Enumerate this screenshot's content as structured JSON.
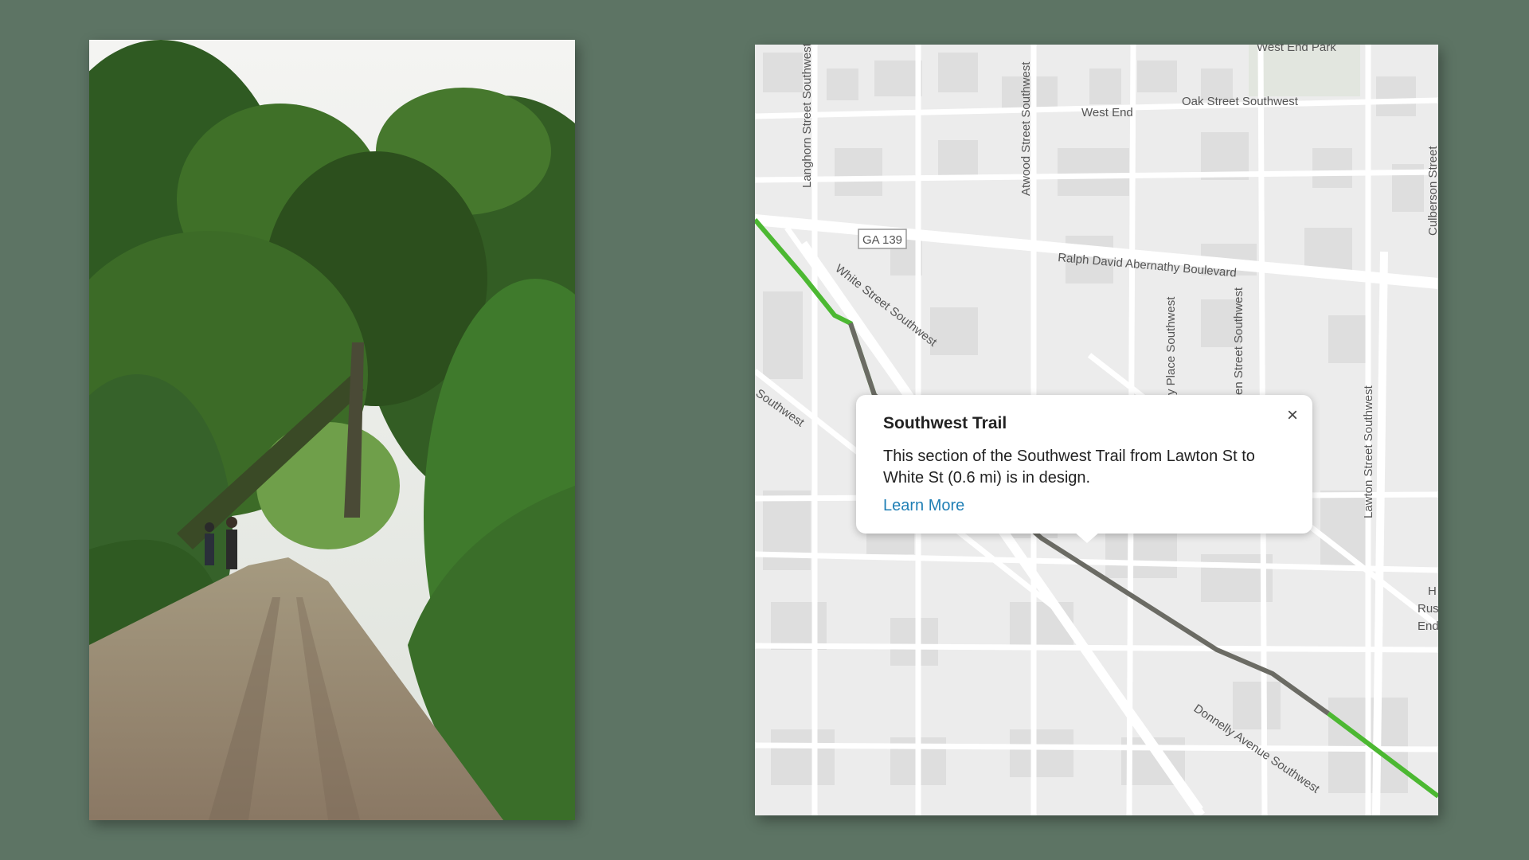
{
  "map": {
    "labels": {
      "west_end_park": "West End Park",
      "west_end": "West End",
      "oak_street": "Oak Street Southwest",
      "langhorn": "Langhorn Street Southwest",
      "atwood": "Atwood Street Southwest",
      "culberson": "Culberson Street",
      "ga139": "GA 139",
      "ralph": "Ralph David Abernathy Boulevard",
      "white_street": "White Street Southwest",
      "southwest": "Southwest",
      "place": "y Place Southwest",
      "en_street": "en Street Southwest",
      "lawton": "Lawton Street Southwest",
      "donnelly": "Donnelly Avenue Southwest",
      "h": "H",
      "rus": "Rus",
      "end": "End"
    },
    "trail_colors": {
      "built": "#4cb832",
      "design": "#6b6b64"
    }
  },
  "popup": {
    "title": "Southwest Trail",
    "body": "This section of the Southwest Trail from Lawton St to White St (0.6 mi) is in design.",
    "link": "Learn More",
    "close_icon": "×"
  }
}
